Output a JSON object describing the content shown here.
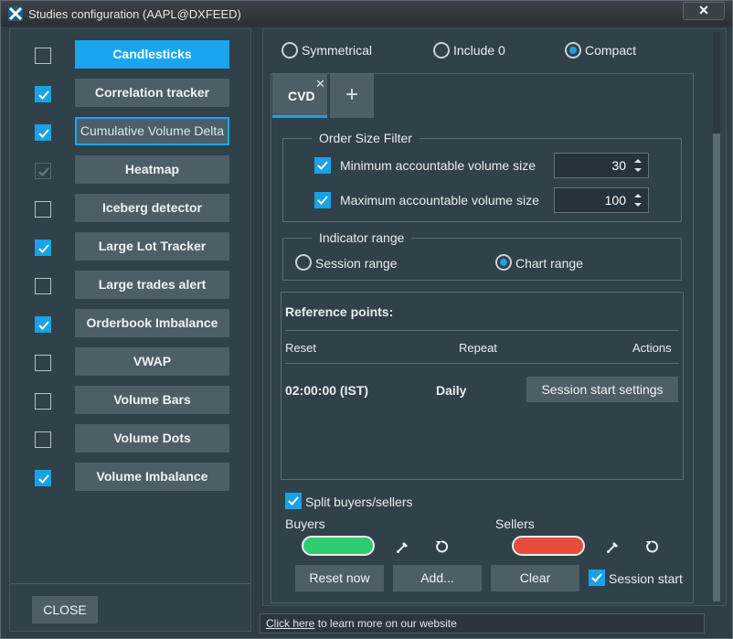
{
  "window": {
    "title": "Studies configuration (AAPL@DXFEED)",
    "close_glyph": "✕"
  },
  "studies": [
    {
      "label": "Candlesticks",
      "checked": false,
      "state": "active"
    },
    {
      "label": "Correlation tracker",
      "checked": true,
      "state": "normal"
    },
    {
      "label": "Cumulative Volume Delta",
      "checked": true,
      "state": "focus"
    },
    {
      "label": "Heatmap",
      "checked": true,
      "state": "disabled"
    },
    {
      "label": "Iceberg detector",
      "checked": false,
      "state": "normal"
    },
    {
      "label": "Large Lot Tracker",
      "checked": true,
      "state": "normal"
    },
    {
      "label": "Large trades alert",
      "checked": false,
      "state": "normal"
    },
    {
      "label": "Orderbook Imbalance",
      "checked": true,
      "state": "normal"
    },
    {
      "label": "VWAP",
      "checked": false,
      "state": "normal"
    },
    {
      "label": "Volume Bars",
      "checked": false,
      "state": "normal"
    },
    {
      "label": "Volume Dots",
      "checked": false,
      "state": "normal"
    },
    {
      "label": "Volume Imbalance",
      "checked": true,
      "state": "normal"
    }
  ],
  "left_footer": {
    "close_label": "CLOSE"
  },
  "scale_options": {
    "symmetrical": "Symmetrical",
    "include0": "Include 0",
    "compact": "Compact",
    "selected": "Compact"
  },
  "tabs": {
    "cvd_label": "CVD",
    "close_glyph": "✕",
    "add_glyph": "+"
  },
  "order_filter": {
    "title": "Order Size Filter",
    "min_label": "Minimum accountable volume size",
    "min_value": "30",
    "min_checked": true,
    "max_label": "Maximum accountable volume size",
    "max_value": "100",
    "max_checked": true
  },
  "indicator_range": {
    "title": "Indicator range",
    "session_label": "Session range",
    "chart_label": "Chart range",
    "selected": "Chart range"
  },
  "reference_points": {
    "title": "Reference points:",
    "col_reset": "Reset",
    "col_repeat": "Repeat",
    "col_actions": "Actions",
    "row_time": "02:00:00 (IST)",
    "row_repeat": "Daily",
    "row_action": "Session start settings"
  },
  "split": {
    "label": "Split buyers/sellers",
    "checked": true
  },
  "colors": {
    "buyers_label": "Buyers",
    "sellers_label": "Sellers",
    "buyers_color": "#2ecc71",
    "sellers_color": "#e74c3c",
    "accent": "#1aa1e6"
  },
  "actions": {
    "reset_now": "Reset now",
    "add": "Add...",
    "clear": "Clear",
    "session_start": "Session start",
    "session_start_checked": true
  },
  "footer": {
    "link_text": "Click here",
    "rest_text": " to learn more on our website"
  }
}
